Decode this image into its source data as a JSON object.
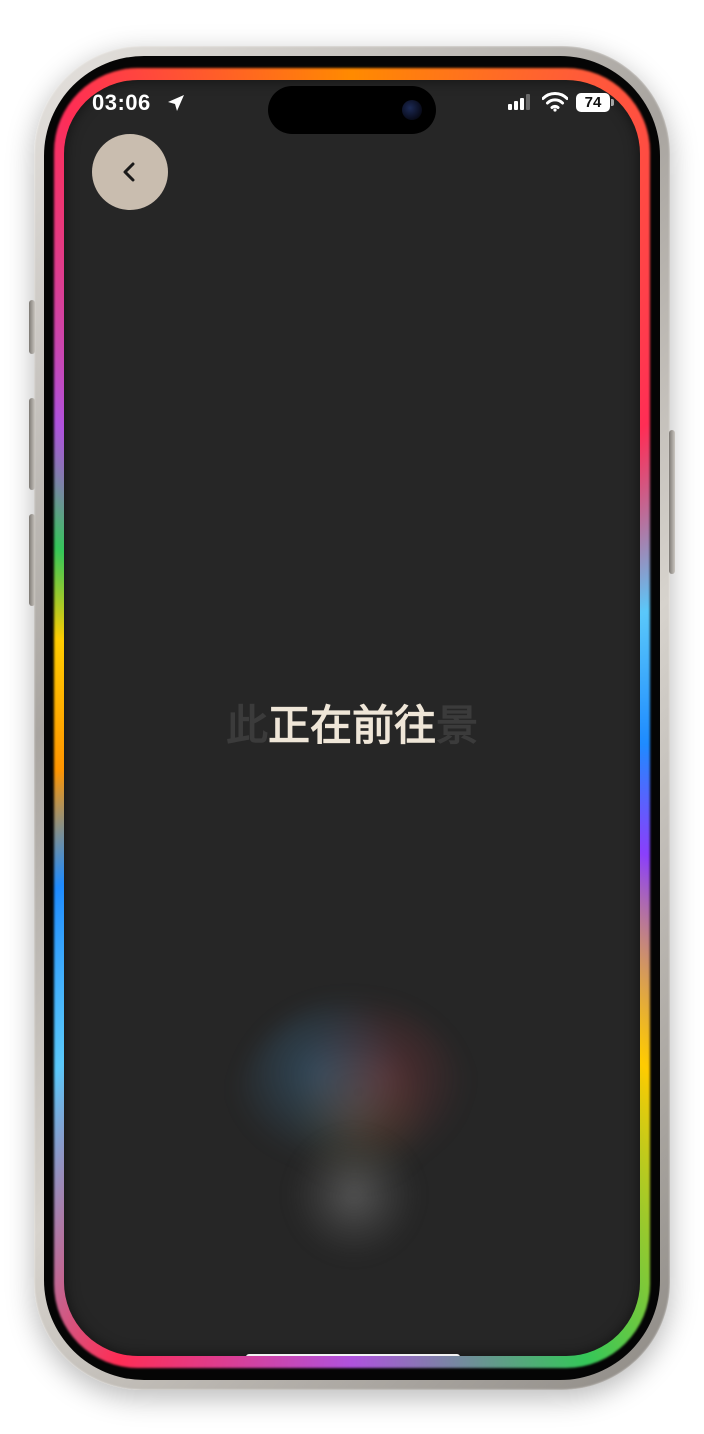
{
  "status_bar": {
    "time": "03:06",
    "battery_level": "74",
    "icons": [
      "location-arrow-icon",
      "cellular-signal-icon",
      "wifi-icon",
      "battery-icon"
    ]
  },
  "navigation": {
    "back_icon": "chevron-left-icon"
  },
  "caption": {
    "leading_faded": "此",
    "main": "正在前往",
    "trailing_faded": "景"
  },
  "colors": {
    "screen_background": "#262626",
    "back_button": "#c9bdaf",
    "caption_main": "#efe6d8",
    "caption_faded": "#3b3b3b"
  },
  "assistant": {
    "indicator": "siri-orb"
  }
}
